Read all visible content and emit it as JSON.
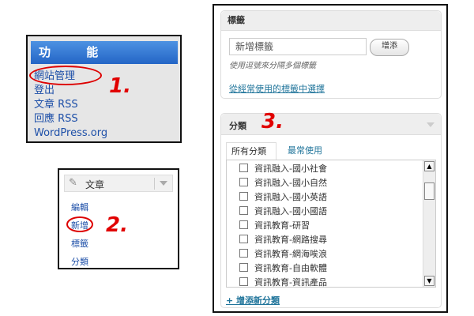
{
  "functions_panel": {
    "title": "功 能",
    "links": [
      "網站管理",
      "登出",
      "文章 RSS",
      "回應 RSS",
      "WordPress.org"
    ],
    "step": "1."
  },
  "posts_panel": {
    "title": "文章",
    "links": [
      "編輯",
      "新增",
      "標籤",
      "分類"
    ],
    "step": "2."
  },
  "tags_box": {
    "title": "標籤",
    "input_value": "新增標籤",
    "add_button": "增添",
    "hint": "使用逗號來分隔多個標籤",
    "choose_link": "從經常使用的標籤中選擇"
  },
  "categories_box": {
    "title": "分類",
    "step": "3.",
    "tabs": [
      "所有分類",
      "最常使用"
    ],
    "items": [
      "資訊融入-國小社會",
      "資訊融入-國小自然",
      "資訊融入-國小英語",
      "資訊融入-國小國語",
      "資訊教育-研習",
      "資訊教育-網路搜尋",
      "資訊教育-網海唉浪",
      "資訊教育-自由軟體",
      "資訊教育-資訊產品"
    ],
    "add_link": "+ 增添新分類"
  },
  "colors": {
    "annotation_red": "#e10000",
    "header_blue": "#2465c6",
    "link_blue": "#21759b"
  }
}
